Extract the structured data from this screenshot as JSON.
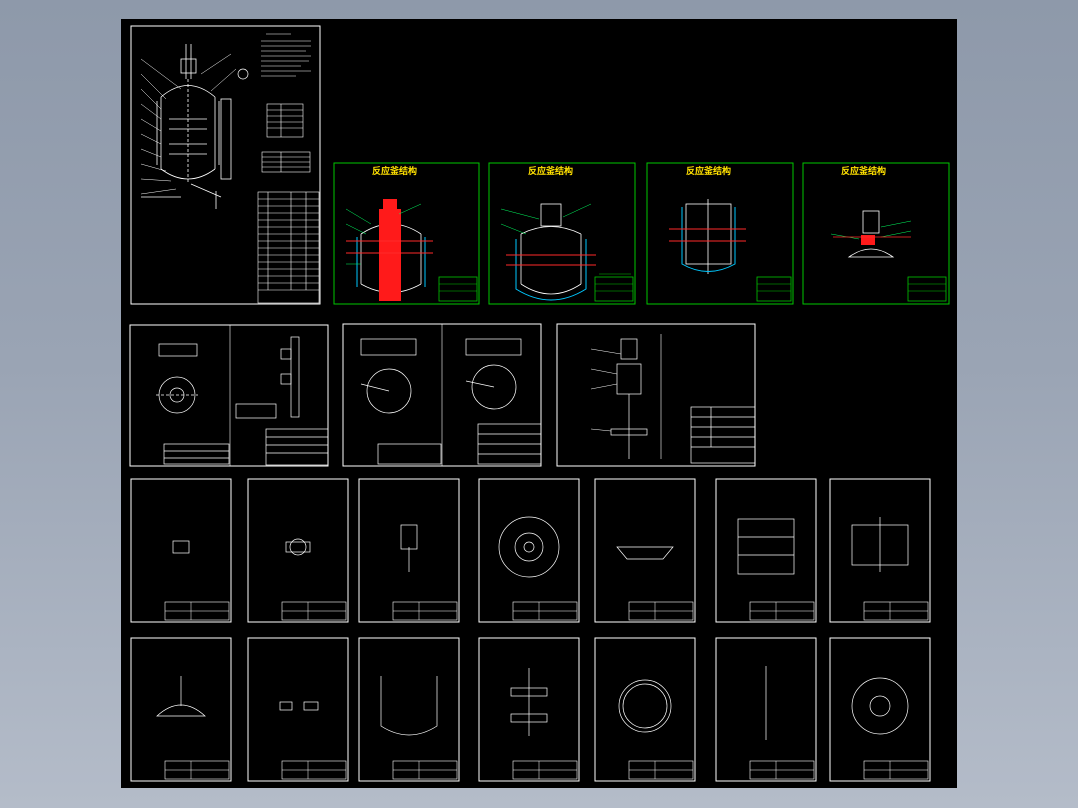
{
  "window": {
    "background_color": "#9aa4b4",
    "canvas_color": "#000000"
  },
  "colors": {
    "sheet_border": "#ffffff",
    "structure_sheet_border": "#00c800",
    "section_fill": "#ff1a1a",
    "title_text": "#ffe000",
    "dimension_lines": "#ff2a2a",
    "jacket_lines": "#00c8ff",
    "geometry": "#ffffff",
    "leader_lines": "#00ff60"
  },
  "drawing_set": {
    "structure_sheets": [
      {
        "title": "反应釜结构",
        "variant": "full-section-red"
      },
      {
        "title": "反应釜结构",
        "variant": "jacketed-vessel"
      },
      {
        "title": "反应釜结构",
        "variant": "inner-vessel"
      },
      {
        "title": "反应釜结构",
        "variant": "top-head-assembly"
      }
    ],
    "part_drawings_row1": [
      {
        "part": "flange-detail-icon"
      },
      {
        "part": "nozzle-detail-icon"
      },
      {
        "part": "support-detail-icon"
      },
      {
        "part": "head-top-view-icon"
      },
      {
        "part": "cover-plate-icon"
      },
      {
        "part": "jacket-section-icon"
      },
      {
        "part": "agitator-assembly-icon"
      }
    ],
    "part_drawings_row2": [
      {
        "part": "top-head-icon"
      },
      {
        "part": "small-parts-icon"
      },
      {
        "part": "vessel-body-icon"
      },
      {
        "part": "shaft-impeller-icon"
      },
      {
        "part": "ring-flange-icon"
      },
      {
        "part": "stirring-shaft-icon"
      },
      {
        "part": "head-plan-view-icon"
      }
    ]
  }
}
